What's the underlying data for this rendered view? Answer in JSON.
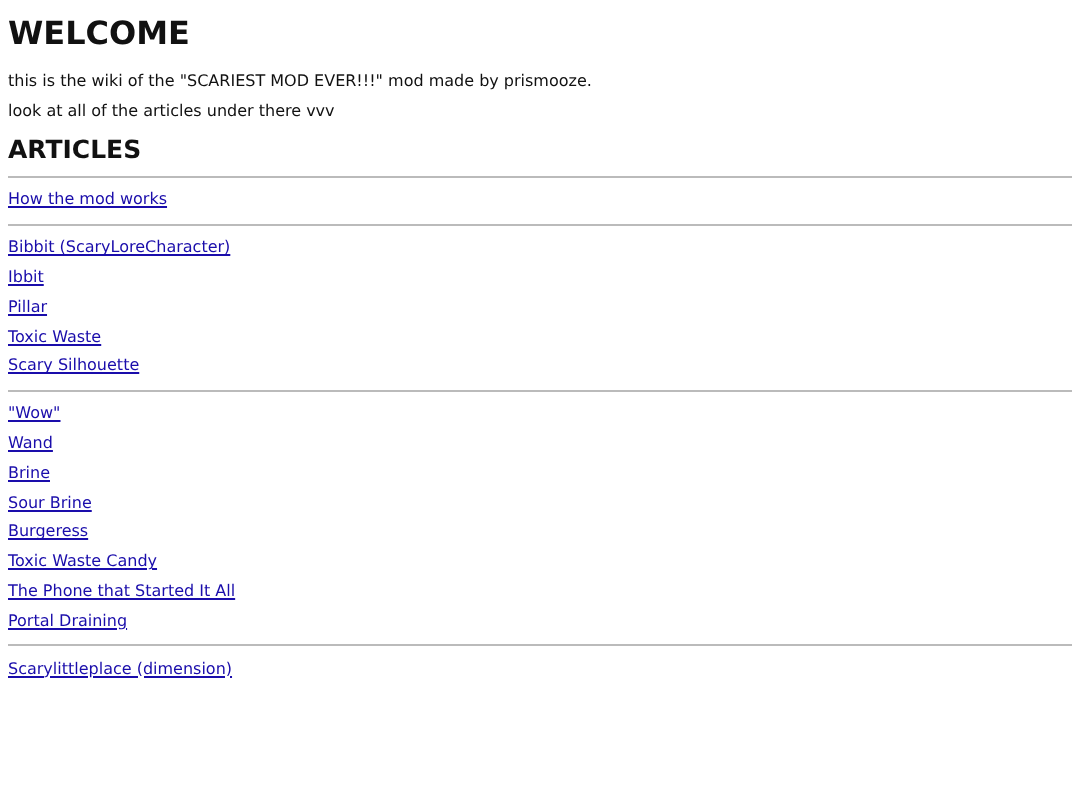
{
  "title": "WELCOME",
  "paragraphs": [
    "this is the wiki of the \"SCARIEST MOD EVER!!!\" mod made by prismooze.",
    "look at all of the articles under there vvv"
  ],
  "heading": "ARTICLES",
  "groups": [
    [
      "How the mod works"
    ],
    [
      "Bibbit (ScaryLoreCharacter)",
      "Ibbit",
      "Pillar",
      "Toxic Waste",
      "Scary Silhouette"
    ],
    [
      "\"Wow\"",
      "Wand",
      "Brine",
      "Sour Brine",
      "Burgeress",
      "Toxic Waste Candy",
      "The Phone that Started It All",
      "Portal Draining"
    ],
    [
      "Scarylittleplace (dimension)"
    ]
  ]
}
